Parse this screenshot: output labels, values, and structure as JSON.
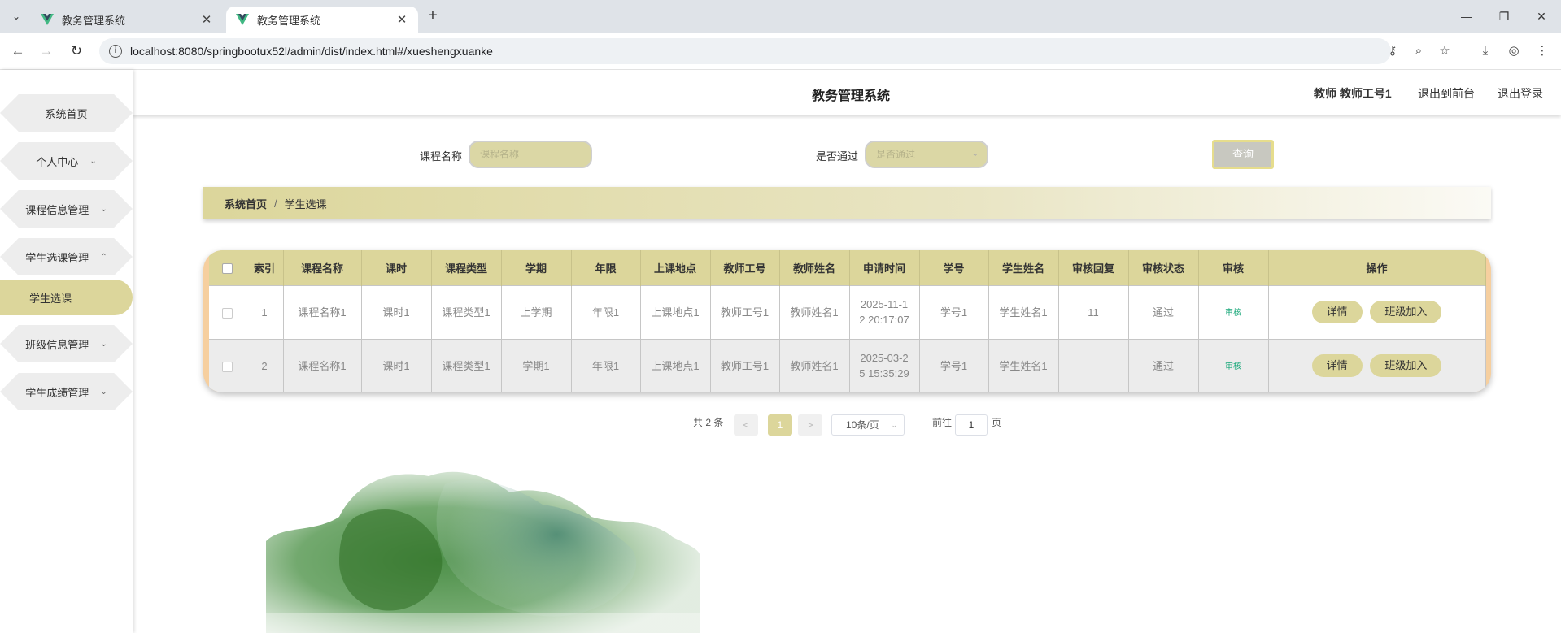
{
  "browser": {
    "tabs": [
      {
        "title": "教务管理系统"
      },
      {
        "title": "教务管理系统"
      }
    ],
    "url": "localhost:8080/springbootux52l/admin/dist/index.html#/xueshengxuanke"
  },
  "header": {
    "title": "教务管理系统",
    "user": "教师 教师工号1",
    "front_link": "退出到前台",
    "logout_link": "退出登录"
  },
  "sidebar": {
    "items": [
      {
        "label": "系统首页",
        "arrow": ""
      },
      {
        "label": "个人中心",
        "arrow": "⌄"
      },
      {
        "label": "课程信息管理",
        "arrow": "⌄"
      },
      {
        "label": "学生选课管理",
        "arrow": "⌃"
      },
      {
        "label": "班级信息管理",
        "arrow": "⌄"
      },
      {
        "label": "学生成绩管理",
        "arrow": "⌄"
      }
    ],
    "active_sub": "学生选课"
  },
  "search": {
    "course_label": "课程名称",
    "course_placeholder": "课程名称",
    "pass_label": "是否通过",
    "pass_placeholder": "是否通过",
    "query_button": "查询"
  },
  "breadcrumb": {
    "home": "系统首页",
    "sep": "/",
    "current": "学生选课"
  },
  "table": {
    "columns": [
      "索引",
      "课程名称",
      "课时",
      "课程类型",
      "学期",
      "年限",
      "上课地点",
      "教师工号",
      "教师姓名",
      "申请时间",
      "学号",
      "学生姓名",
      "审核回复",
      "审核状态",
      "审核",
      "操作"
    ],
    "rows": [
      {
        "index": "1",
        "course": "课程名称1",
        "hours": "课时1",
        "type": "课程类型1",
        "term": "上学期",
        "years": "年限1",
        "place": "上课地点1",
        "teacher_no": "教师工号1",
        "teacher_name": "教师姓名1",
        "time_1": "2025-11-1",
        "time_2": "2 20:17:07",
        "student_no": "学号1",
        "student_name": "学生姓名1",
        "reply": "11",
        "status": "通过",
        "audit": "审核",
        "btn_detail": "详情",
        "btn_join": "班级加入"
      },
      {
        "index": "2",
        "course": "课程名称1",
        "hours": "课时1",
        "type": "课程类型1",
        "term": "学期1",
        "years": "年限1",
        "place": "上课地点1",
        "teacher_no": "教师工号1",
        "teacher_name": "教师姓名1",
        "time_1": "2025-03-2",
        "time_2": "5 15:35:29",
        "student_no": "学号1",
        "student_name": "学生姓名1",
        "reply": "",
        "status": "通过",
        "audit": "审核",
        "btn_detail": "详情",
        "btn_join": "班级加入"
      }
    ]
  },
  "pagination": {
    "total": "共 2 条",
    "prev": "<",
    "page": "1",
    "next": ">",
    "page_size": "10条/页",
    "goto_label": "前往",
    "goto_value": "1",
    "page_unit": "页"
  },
  "colors": {
    "accent": "#dcd69b",
    "table_border": "#f6cf9f",
    "audit_link": "#1aa87a"
  }
}
